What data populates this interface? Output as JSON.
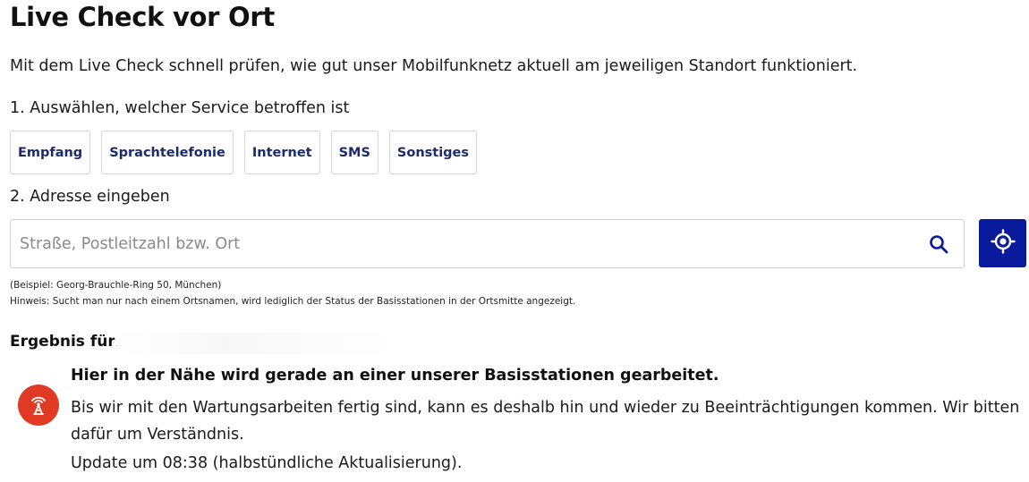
{
  "page": {
    "title": "Live Check vor Ort",
    "intro": "Mit dem Live Check schnell prüfen, wie gut unser Mobilfunknetz aktuell am jeweiligen Standort funktioniert."
  },
  "step1": {
    "label": "1. Auswählen, welcher Service betroffen ist",
    "services": [
      "Empfang",
      "Sprachtelefonie",
      "Internet",
      "SMS",
      "Sonstiges"
    ]
  },
  "step2": {
    "label": "2. Adresse eingeben",
    "search_placeholder": "Straße, Postleitzahl bzw. Ort",
    "search_value": "",
    "search_icon": "search-icon",
    "locate_icon": "crosshair-icon"
  },
  "notes": {
    "example": "(Beispiel: Georg-Brauchle-Ring 50, München)",
    "hint": "Hinweis: Sucht man nur nach einem Ortsnamen, wird lediglich der Status der Basisstationen in der Ortsmitte angezeigt."
  },
  "result": {
    "label": "Ergebnis für:",
    "status_icon": "antenna-tower-icon",
    "heading": "Hier in der Nähe wird gerade an einer unserer Basisstationen gearbeitet.",
    "body": "Bis wir mit den Wartungsarbeiten fertig sind, kann es deshalb hin und wieder zu Beeinträchtigungen kommen. Wir bitten dafür um Verständnis.",
    "update": "Update um 08:38 (halbstündliche Aktualisierung)."
  },
  "colors": {
    "accent": "#0a1a9c",
    "button_text": "#1c2a6e",
    "status_red": "#e03a24"
  }
}
